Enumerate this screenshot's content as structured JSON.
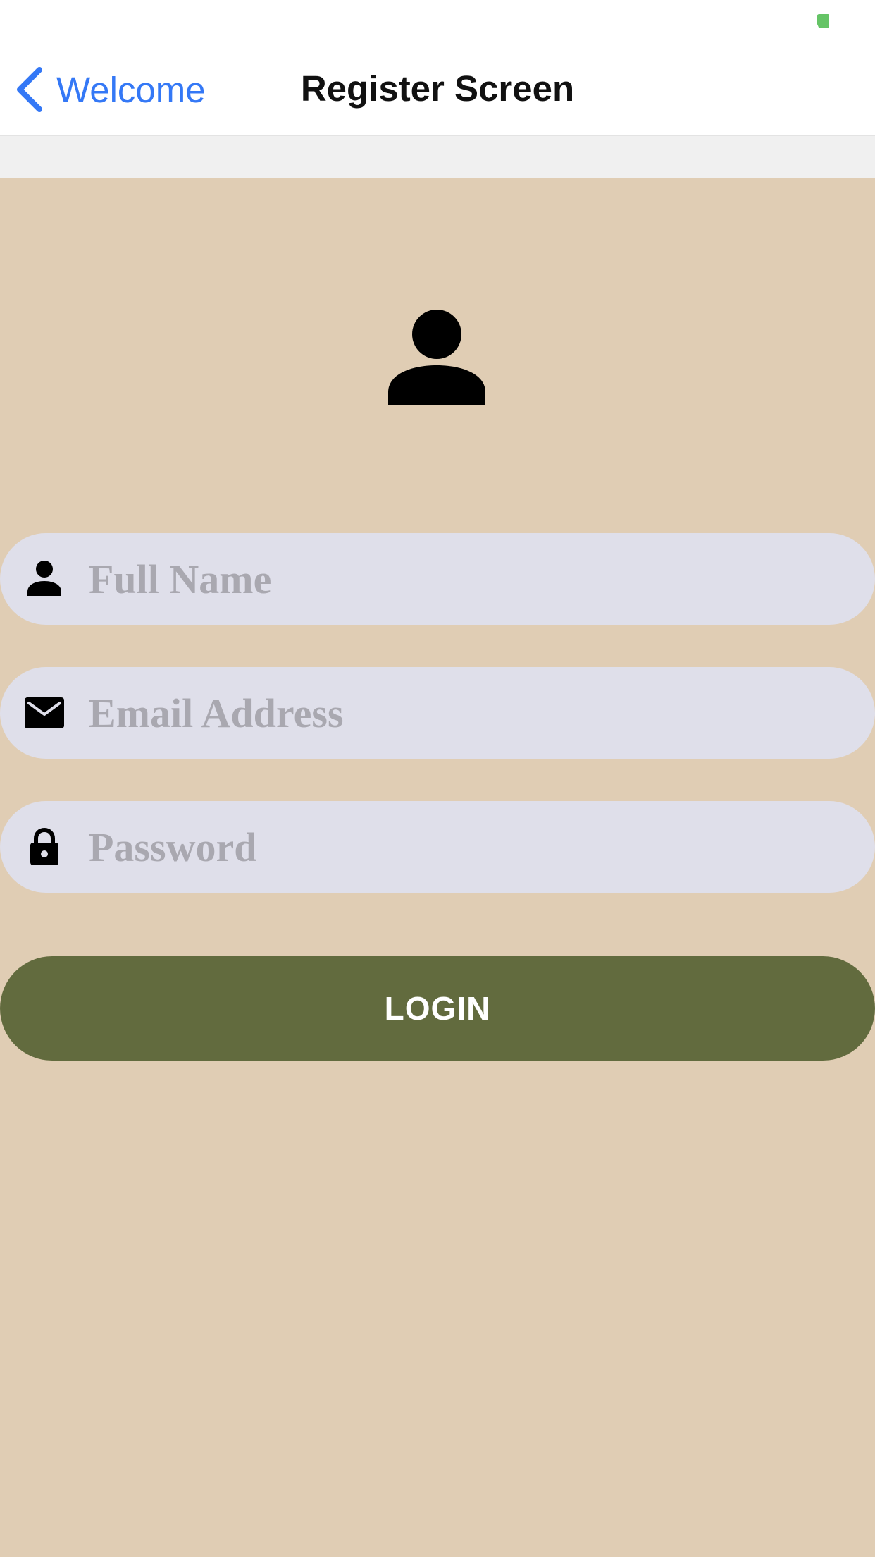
{
  "nav": {
    "back_label": "Welcome",
    "title": "Register Screen"
  },
  "form": {
    "full_name": {
      "placeholder": "Full Name",
      "value": "",
      "icon": "person-icon"
    },
    "email": {
      "placeholder": "Email Address",
      "value": "",
      "icon": "envelope-icon"
    },
    "password": {
      "placeholder": "Password",
      "value": "",
      "icon": "lock-icon"
    }
  },
  "login_button": {
    "label": "LOGIN"
  },
  "colors": {
    "background": "#e0cdb4",
    "accent": "#3478f6",
    "field_background": "#dfdfea",
    "button": "#626b3e",
    "status_indicator": "#65c466"
  },
  "icons": {
    "avatar": "person-icon",
    "back": "chevron-left-icon"
  }
}
